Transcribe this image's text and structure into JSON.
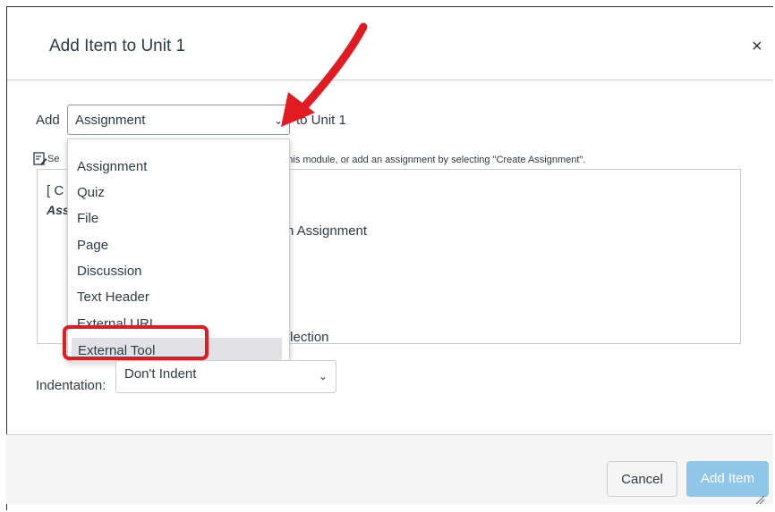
{
  "dialog": {
    "title": "Add Item to Unit 1",
    "close_icon": "close-icon"
  },
  "add_row": {
    "prefix": "Add",
    "selected_type": "Assignment",
    "suffix": "to Unit 1"
  },
  "hint": {
    "prefix": "Se",
    "text": "th this module, or add an assignment by selecting \"Create Assignment\"."
  },
  "listbox_visible_fragments": {
    "line1": "[ C",
    "line2": "Ass",
    "line3": "n Assignment",
    "line4": "flection"
  },
  "dropdown_options": [
    {
      "label": "Assignment"
    },
    {
      "label": "Quiz"
    },
    {
      "label": "File"
    },
    {
      "label": "Page"
    },
    {
      "label": "Discussion"
    },
    {
      "label": "Text Header"
    },
    {
      "label": "External URL"
    },
    {
      "label": "External Tool"
    }
  ],
  "indentation": {
    "label": "Indentation:",
    "selected": "Don't Indent"
  },
  "footer": {
    "cancel_label": "Cancel",
    "add_label": "Add Item"
  },
  "colors": {
    "annotation": "#e21b23",
    "primary_button": "#8fc6ea",
    "text": "#2d3b45"
  }
}
